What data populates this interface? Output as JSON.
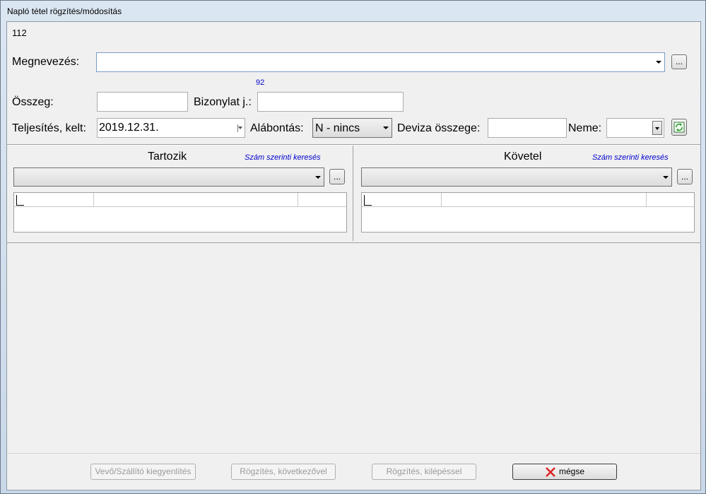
{
  "window": {
    "title": "Napló tétel rögzítés/módosítás"
  },
  "record": {
    "number": "112"
  },
  "form": {
    "megnevezes_label": "Megnevezés:",
    "megnevezes_value": "",
    "ellipsis": "...",
    "counter": "92",
    "osszeg_label": "Összeg:",
    "osszeg_value": "",
    "bizonylat_label": "Bizonylat j.:",
    "bizonylat_value": "",
    "teljesites_label": "Teljesítés, kelt:",
    "teljesites_value": "2019.12.31.",
    "alabontas_label": "Alábontás:",
    "alabontas_value": "N - nincs",
    "deviza_label": "Deviza összege:",
    "deviza_value": "",
    "neme_label": "Neme:",
    "neme_value": ""
  },
  "tartozik": {
    "title": "Tartozik",
    "search_link": "Szám szerinti keresés",
    "account_value": ""
  },
  "kovetel": {
    "title": "Követel",
    "search_link": "Szám szerinti keresés",
    "account_value": ""
  },
  "buttons": {
    "vevo": "Vevő/Szállító kiegyenlítés",
    "rogzites_kov": "Rögzítés, következővel",
    "rogzites_kil": "Rögzítés, kilépéssel",
    "megse": "mégse"
  },
  "colors": {
    "link": "#0000cc",
    "cancel_icon": "#e02020"
  },
  "icons": {
    "refresh": "refresh-icon",
    "cancel": "x-icon"
  }
}
